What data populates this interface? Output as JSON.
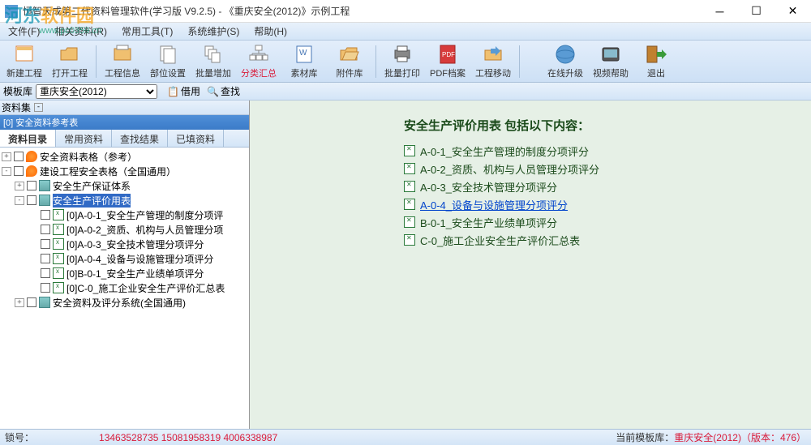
{
  "window": {
    "title": "恒智天成第二代资料管理软件(学习版 V9.2.5) - 《重庆安全(2012)》示例工程"
  },
  "watermark": {
    "logo_a": "河东",
    "logo_b": "软件园",
    "url": "www.pc0359.cn"
  },
  "menubar": [
    "文件(F)",
    "相关资料(R)",
    "常用工具(T)",
    "系统维护(S)",
    "帮助(H)"
  ],
  "toolbar": {
    "new_project": "新建工程",
    "open_project": "打开工程",
    "project_info": "工程信息",
    "dept_settings": "部位设置",
    "batch_add": "批量增加",
    "cat_summary": "分类汇总",
    "material_lib": "素材库",
    "attach_lib": "附件库",
    "batch_print": "批量打印",
    "pdf_archive": "PDF档案",
    "project_move": "工程移动",
    "online_upgrade": "在线升级",
    "video_help": "视频帮助",
    "exit": "退出"
  },
  "subbar": {
    "template_lib_label": "模板库",
    "template_value": "重庆安全(2012)",
    "borrow": "借用",
    "find": "查找",
    "data_set_label": "资料集"
  },
  "panel": {
    "header": "[0] 安全资料参考表"
  },
  "tabs": {
    "t1": "资料目录",
    "t2": "常用资料",
    "t3": "查找结果",
    "t4": "已填资料"
  },
  "tree": {
    "n1": "安全资料表格（参考）",
    "n2": "建设工程安全表格（全国通用）",
    "n3": "安全生产保证体系",
    "n4": "安全生产评价用表",
    "n5": "[0]A-0-1_安全生产管理的制度分项评",
    "n6": "[0]A-0-2_资质、机构与人员管理分项",
    "n7": "[0]A-0-3_安全技术管理分项评分",
    "n8": "[0]A-0-4_设备与设施管理分项评分",
    "n9": "[0]B-0-1_安全生产业绩单项评分",
    "n10": "[0]C-0_施工企业安全生产评价汇总表",
    "n11": "安全资料及评分系统(全国通用)"
  },
  "content": {
    "title": "安全生产评价用表  包括以下内容：",
    "items": [
      "A-0-1_安全生产管理的制度分项评分",
      "A-0-2_资质、机构与人员管理分项评分",
      "A-0-3_安全技术管理分项评分",
      "A-0-4_设备与设施管理分项评分",
      "B-0-1_安全生产业绩单项评分",
      "C-0_施工企业安全生产评价汇总表"
    ]
  },
  "statusbar": {
    "lock": "锁号：",
    "phones": "13463528735 15081958319 4006338987",
    "right_label": "当前模板库：",
    "right_value": "重庆安全(2012)（版本：476）"
  }
}
